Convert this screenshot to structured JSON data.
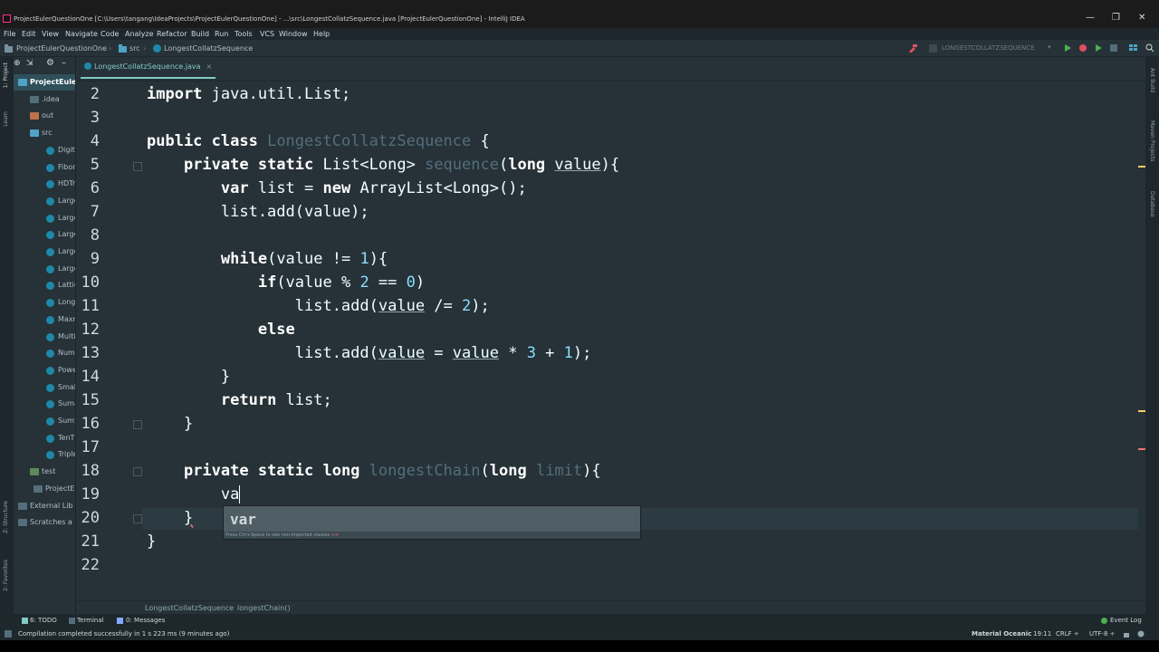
{
  "window": {
    "title": "ProjectEulerQuestionOne [C:\\Users\\tangang\\IdeaProjects\\ProjectEulerQuestionOne] - ...\\src\\LongestCollatzSequence.java [ProjectEulerQuestionOne] - IntelliJ IDEA",
    "minimize": "—",
    "maximize": "❐",
    "close": "✕"
  },
  "menu": [
    "File",
    "Edit",
    "View",
    "Navigate",
    "Code",
    "Analyze",
    "Refactor",
    "Build",
    "Run",
    "Tools",
    "VCS",
    "Window",
    "Help"
  ],
  "nav": {
    "project": "ProjectEulerQuestionOne",
    "folder": "src",
    "file": "LongestCollatzSequence",
    "run_config": "LONGESTCOLLATZSEQUENCE",
    "accent": "#ff318c"
  },
  "tool_windows": {
    "left": [
      "1: Project",
      "Learn",
      "Z: Structure",
      "2: Favorites"
    ],
    "right": [
      "Ant Build",
      "Maven Projects",
      "Database"
    ]
  },
  "project_tree": {
    "header": "Project",
    "items": [
      {
        "label": "ProjectEuler",
        "kind": "module"
      },
      {
        "label": ".idea",
        "kind": "folder"
      },
      {
        "label": "out",
        "kind": "folder-out"
      },
      {
        "label": "src",
        "kind": "folder-src"
      },
      {
        "label": "DigitF",
        "kind": "class"
      },
      {
        "label": "Fibon",
        "kind": "class"
      },
      {
        "label": "HDTr",
        "kind": "class"
      },
      {
        "label": "Large",
        "kind": "class"
      },
      {
        "label": "Large",
        "kind": "class"
      },
      {
        "label": "Large",
        "kind": "class"
      },
      {
        "label": "Large",
        "kind": "class"
      },
      {
        "label": "Large",
        "kind": "class"
      },
      {
        "label": "Lattic",
        "kind": "class"
      },
      {
        "label": "Longe",
        "kind": "class"
      },
      {
        "label": "Maxm",
        "kind": "class"
      },
      {
        "label": "Multi",
        "kind": "class"
      },
      {
        "label": "Numl",
        "kind": "class"
      },
      {
        "label": "Powe",
        "kind": "class"
      },
      {
        "label": "Small",
        "kind": "class"
      },
      {
        "label": "Suma",
        "kind": "class"
      },
      {
        "label": "SumS",
        "kind": "class"
      },
      {
        "label": "TenTh",
        "kind": "class"
      },
      {
        "label": "Triple",
        "kind": "class"
      },
      {
        "label": "test",
        "kind": "folder-test"
      },
      {
        "label": "ProjectE",
        "kind": "file"
      },
      {
        "label": "External Lib",
        "kind": "lib"
      },
      {
        "label": "Scratches a",
        "kind": "scratch"
      }
    ]
  },
  "editor": {
    "tab_label": "LongestCollatzSequence.java",
    "tab_close": "×",
    "line_numbers": [
      "2",
      "3",
      "4",
      "5",
      "6",
      "7",
      "8",
      "9",
      "10",
      "11",
      "12",
      "13",
      "14",
      "15",
      "16",
      "17",
      "18",
      "19",
      "20",
      "21",
      "22"
    ],
    "current_line": "19"
  },
  "autocomplete": {
    "item": "var",
    "hint": "Press Ctrl+Space to see non-imported classes",
    "hint_link": ">>"
  },
  "breadcrumbs": [
    "LongestCollatzSequence",
    "longestChain()"
  ],
  "bottom_tools": {
    "todo": "6: TODO",
    "terminal": "Terminal",
    "messages": "0: Messages",
    "event_log": "Event Log"
  },
  "status": {
    "message": "Compilation completed successfully in 1 s 223 ms (9 minutes ago)",
    "theme": "Material Oceanic",
    "position": "19:11",
    "line_sep": "CRLF ÷",
    "encoding": "UTF-8 ÷"
  }
}
